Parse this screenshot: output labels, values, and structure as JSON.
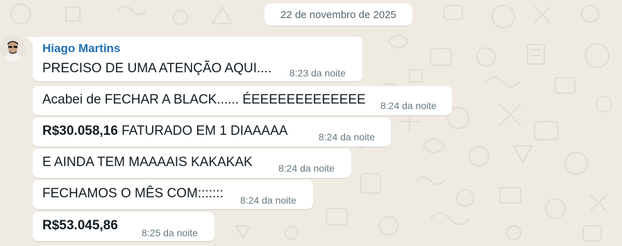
{
  "date_separator": "22 de novembro de 2025",
  "sender": "Hiago Martins",
  "messages": [
    {
      "bold": "",
      "text": "PRECISO DE UMA ATENÇÃO AQUI....",
      "time": "8:23 da noite"
    },
    {
      "bold": "",
      "text": "Acabei de FECHAR A BLACK...... ÉEEEEEEEEEEEEE",
      "time": "8:24 da noite"
    },
    {
      "bold": "R$30.058,16",
      "text": " FATURADO EM 1 DIAAAAA",
      "time": "8:24 da noite"
    },
    {
      "bold": "",
      "text": "E AINDA TEM MAAAAIS KAKAKAK",
      "time": "8:24 da noite"
    },
    {
      "bold": "",
      "text": "FECHAMOS O MÊS COM:::::::",
      "time": "8:24 da noite"
    },
    {
      "bold": "R$53.045,86",
      "text": "",
      "time": "8:25 da noite"
    }
  ],
  "colors": {
    "background": "#efeae2",
    "bubble": "#ffffff",
    "sender_name": "#1f6fb5",
    "time_text": "#667781"
  }
}
